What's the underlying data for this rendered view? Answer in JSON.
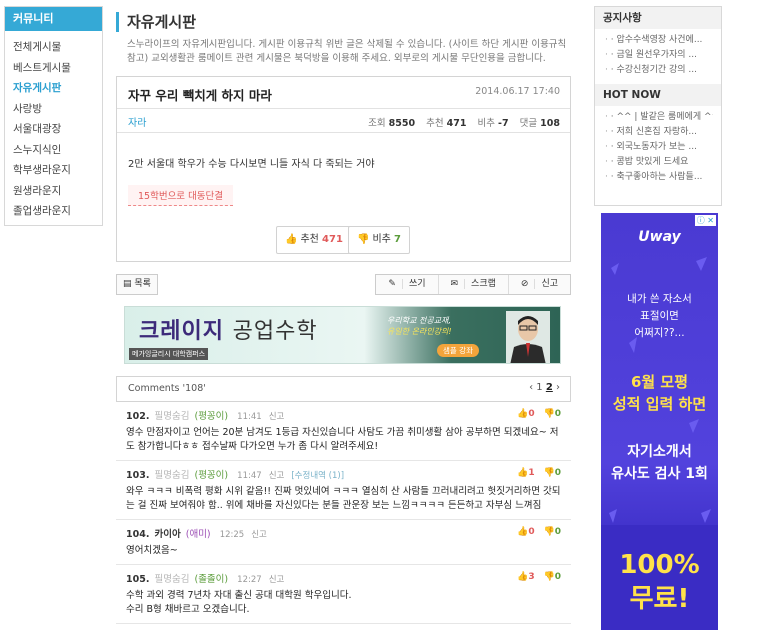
{
  "sidebar": {
    "title": "커뮤니티",
    "items": [
      "전체게시물",
      "베스트게시물",
      "자유게시판",
      "사랑방",
      "서울대광장",
      "스누지식인",
      "학부생라운지",
      "원생라운지",
      "졸업생라운지"
    ]
  },
  "board": {
    "title": "자유게시판",
    "desc1": "스누라이프의 자유게시판입니다. 게시판 이용규칙 위반 글은 삭제될 수 있습니다. (사이트 하단 게시판 이용규칙",
    "desc2": "참고) 교외생활관 룸메이트 관련 게시물은 북덕방을 이용해 주세요. 외부로의 게시물 무단인용을 금합니다."
  },
  "post": {
    "title": "자꾸 우리 빽치게 하지 마라",
    "date": "2014.06.17 17:40",
    "author": "자라",
    "views_label": "조회",
    "views": "8550",
    "up_label": "추천",
    "up": "471",
    "down_label": "비추",
    "down": "-7",
    "comments_label": "댓글",
    "comments": "108",
    "body": "2만 서울대 학우가 수능 다시보면 니들 자식 다 죽되는 거야",
    "tag": "15학번으로 대동단결",
    "vote_up_label": "추천",
    "vote_up": "471",
    "vote_down_label": "비추",
    "vote_down": "7"
  },
  "toolbar": {
    "list": "목록",
    "write": "쓰기",
    "scrap": "스크랩",
    "report": "신고"
  },
  "banner": {
    "main_bold": "크레이지",
    "main_light": "공업수학",
    "sub": "메가잉글리시 대학캠퍼스",
    "side1": "우리학교 전공교재,",
    "side2": "유일한 온라인강의!",
    "cta": "샘플 강좌"
  },
  "comments_head": {
    "label": "Comments '108'",
    "pager_prev": "‹",
    "page1": "1",
    "page2": "2",
    "pager_next": "›"
  },
  "comments": [
    {
      "num": "102.",
      "nick": "필명숨김",
      "level": "(평꽁이)",
      "time": "11:41",
      "report": "신고",
      "edit": "",
      "up": "0",
      "down": "0",
      "text": "영수 만점자이고 언어는 20분 남겨도 1등급 자신있습니다 사탐도 가끔 취미생활 삼아 공부하면 되겠네요~ 저도 참가합니다ㅎㅎ 접수날짜 다가오면 누가 좀 다시 알려주세요!"
    },
    {
      "num": "103.",
      "nick": "필명숨김",
      "level": "(평꽁이)",
      "time": "11:47",
      "report": "신고",
      "edit": "[수정내역 (1)]",
      "up": "1",
      "down": "0",
      "text": "와우 ㅋㅋㅋ 비폭력 평화 시위 같음!! 진짜 멋있네여 ㅋㅋㅋ 열심히 산 사람들 끄러내리려고 헛짓거리하면 갓되는 걸 진짜 보여줘야 함.. 위에 채바를 자신있다는 분들 관운장 보는 느낌ㅋㅋㅋㅋ 든든하고 자부심 느껴짐"
    },
    {
      "num": "104.",
      "nick": "카이아",
      "level": "(애미)",
      "time": "12:25",
      "report": "신고",
      "edit": "",
      "up": "0",
      "down": "0",
      "text": "영어치겠음~"
    },
    {
      "num": "105.",
      "nick": "필명숨김",
      "level": "(졸졸이)",
      "time": "12:27",
      "report": "신고",
      "edit": "",
      "up": "3",
      "down": "0",
      "text": "수학 과외 경력 7년차 자대 출신 공대 대학원 학우입니다.\n수리 B형 채바르고 오겠습니다."
    }
  ],
  "notice": {
    "title": "공지사항",
    "items": [
      "· 압수수색영장 사건에...",
      "· 금일 원선우가자의 ...",
      "· 수강신청기간 강의 ..."
    ],
    "hot_title": "HOT NOW",
    "hot_items": [
      "· ^^ | 발같은 룸메에게 ^^",
      "· 저희 신혼집 자랑하...",
      "· 외국노동자가 보는 ...",
      "· 콩밥 맛있게 드세요",
      "· 축구좋아하는 사람들..."
    ]
  },
  "ad": {
    "brand": "Uway",
    "q1": "내가 쓴 자소서",
    "q2": "표절이면",
    "q3": "어쩌지??...",
    "s1": "6월 모평",
    "s2": "성적 입력 하면",
    "e1": "자기소개서",
    "e2": "유사도 검사 1회",
    "f1": "100%",
    "f2": "무료!",
    "close": "ⓘ ✕"
  },
  "colors": {
    "accent": "#35a9d6",
    "up": "#e05a5a",
    "down": "#5b9c3b",
    "ad_bg": "#4a3ad2",
    "ad_yellow": "#ffe24a"
  }
}
